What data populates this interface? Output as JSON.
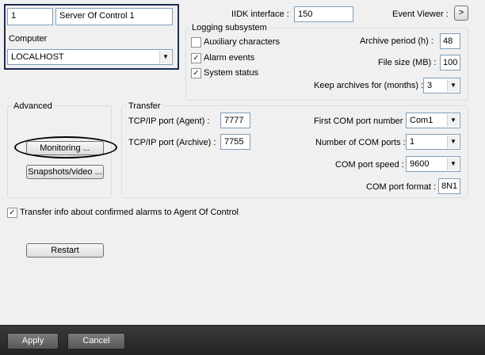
{
  "server": {
    "id": "1",
    "name": "Server Of Control 1",
    "computer_label": "Computer",
    "computer_value": "LOCALHOST"
  },
  "iidk": {
    "label": "IIDK interface :",
    "value": "150"
  },
  "event_viewer": {
    "label": "Event Viewer :",
    "button": ">"
  },
  "logging": {
    "title": "Logging subsystem",
    "aux_label": "Auxiliary characters",
    "aux_checked": false,
    "alarm_label": "Alarm events",
    "alarm_checked": true,
    "status_label": "System status",
    "status_checked": true,
    "archive_period_label": "Archive period (h) :",
    "archive_period_value": "48",
    "file_size_label": "File size (MB) :",
    "file_size_value": "100",
    "keep_label": "Keep archives for (months) :",
    "keep_value": "3"
  },
  "advanced": {
    "title": "Advanced",
    "monitoring_button": "Monitoring ...",
    "snapshots_button": "Snapshots/video ..."
  },
  "transfer": {
    "title": "Transfer",
    "agent_port_label": "TCP/IP port (Agent) :",
    "agent_port_value": "7777",
    "archive_port_label": "TCP/IP port (Archive) :",
    "archive_port_value": "7755",
    "first_com_label": "First COM port number :",
    "first_com_value": "Com1",
    "num_com_label": "Number of COM ports :",
    "num_com_value": "1",
    "speed_label": "COM port speed :",
    "speed_value": "9600",
    "format_label": "COM port format :",
    "format_value": "8N1"
  },
  "transfer_info": {
    "label": "Transfer info about confirmed alarms to Agent Of Control",
    "checked": true
  },
  "restart_button": "Restart",
  "footer": {
    "apply": "Apply",
    "cancel": "Cancel"
  },
  "icons": {
    "check": "checkmark-icon",
    "dropdown": "chevron-down-icon"
  },
  "colors": {
    "footer_bg": "#2f2f2f",
    "highlight_ring": "#000000"
  }
}
